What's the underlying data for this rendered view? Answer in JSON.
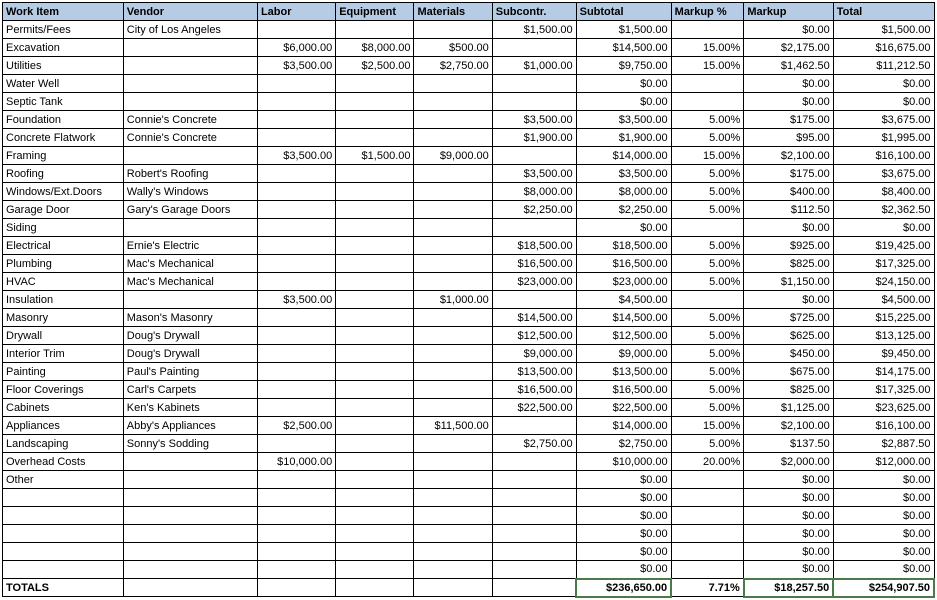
{
  "headers": [
    "Work Item",
    "Vendor",
    "Labor",
    "Equipment",
    "Materials",
    "Subcontr.",
    "Subtotal",
    "Markup %",
    "Markup",
    "Total"
  ],
  "rows": [
    {
      "work": "Permits/Fees",
      "vendor": "City of Los Angeles",
      "labor": "",
      "equip": "",
      "mat": "",
      "sub": "$1,500.00",
      "subt": "$1,500.00",
      "mpct": "",
      "mark": "$0.00",
      "total": "$1,500.00"
    },
    {
      "work": "Excavation",
      "vendor": "",
      "labor": "$6,000.00",
      "equip": "$8,000.00",
      "mat": "$500.00",
      "sub": "",
      "subt": "$14,500.00",
      "mpct": "15.00%",
      "mark": "$2,175.00",
      "total": "$16,675.00"
    },
    {
      "work": "Utilities",
      "vendor": "",
      "labor": "$3,500.00",
      "equip": "$2,500.00",
      "mat": "$2,750.00",
      "sub": "$1,000.00",
      "subt": "$9,750.00",
      "mpct": "15.00%",
      "mark": "$1,462.50",
      "total": "$11,212.50"
    },
    {
      "work": "Water Well",
      "vendor": "",
      "labor": "",
      "equip": "",
      "mat": "",
      "sub": "",
      "subt": "$0.00",
      "mpct": "",
      "mark": "$0.00",
      "total": "$0.00"
    },
    {
      "work": "Septic Tank",
      "vendor": "",
      "labor": "",
      "equip": "",
      "mat": "",
      "sub": "",
      "subt": "$0.00",
      "mpct": "",
      "mark": "$0.00",
      "total": "$0.00"
    },
    {
      "work": "Foundation",
      "vendor": "Connie's Concrete",
      "labor": "",
      "equip": "",
      "mat": "",
      "sub": "$3,500.00",
      "subt": "$3,500.00",
      "mpct": "5.00%",
      "mark": "$175.00",
      "total": "$3,675.00"
    },
    {
      "work": "Concrete Flatwork",
      "vendor": "Connie's Concrete",
      "labor": "",
      "equip": "",
      "mat": "",
      "sub": "$1,900.00",
      "subt": "$1,900.00",
      "mpct": "5.00%",
      "mark": "$95.00",
      "total": "$1,995.00"
    },
    {
      "work": "Framing",
      "vendor": "",
      "labor": "$3,500.00",
      "equip": "$1,500.00",
      "mat": "$9,000.00",
      "sub": "",
      "subt": "$14,000.00",
      "mpct": "15.00%",
      "mark": "$2,100.00",
      "total": "$16,100.00"
    },
    {
      "work": "Roofing",
      "vendor": "Robert's Roofing",
      "labor": "",
      "equip": "",
      "mat": "",
      "sub": "$3,500.00",
      "subt": "$3,500.00",
      "mpct": "5.00%",
      "mark": "$175.00",
      "total": "$3,675.00"
    },
    {
      "work": "Windows/Ext.Doors",
      "vendor": "Wally's Windows",
      "labor": "",
      "equip": "",
      "mat": "",
      "sub": "$8,000.00",
      "subt": "$8,000.00",
      "mpct": "5.00%",
      "mark": "$400.00",
      "total": "$8,400.00"
    },
    {
      "work": "Garage Door",
      "vendor": "Gary's Garage Doors",
      "labor": "",
      "equip": "",
      "mat": "",
      "sub": "$2,250.00",
      "subt": "$2,250.00",
      "mpct": "5.00%",
      "mark": "$112.50",
      "total": "$2,362.50"
    },
    {
      "work": "Siding",
      "vendor": "",
      "labor": "",
      "equip": "",
      "mat": "",
      "sub": "",
      "subt": "$0.00",
      "mpct": "",
      "mark": "$0.00",
      "total": "$0.00"
    },
    {
      "work": "Electrical",
      "vendor": "Ernie's Electric",
      "labor": "",
      "equip": "",
      "mat": "",
      "sub": "$18,500.00",
      "subt": "$18,500.00",
      "mpct": "5.00%",
      "mark": "$925.00",
      "total": "$19,425.00"
    },
    {
      "work": "Plumbing",
      "vendor": "Mac's Mechanical",
      "labor": "",
      "equip": "",
      "mat": "",
      "sub": "$16,500.00",
      "subt": "$16,500.00",
      "mpct": "5.00%",
      "mark": "$825.00",
      "total": "$17,325.00"
    },
    {
      "work": "HVAC",
      "vendor": "Mac's Mechanical",
      "labor": "",
      "equip": "",
      "mat": "",
      "sub": "$23,000.00",
      "subt": "$23,000.00",
      "mpct": "5.00%",
      "mark": "$1,150.00",
      "total": "$24,150.00"
    },
    {
      "work": "Insulation",
      "vendor": "",
      "labor": "$3,500.00",
      "equip": "",
      "mat": "$1,000.00",
      "sub": "",
      "subt": "$4,500.00",
      "mpct": "",
      "mark": "$0.00",
      "total": "$4,500.00"
    },
    {
      "work": "Masonry",
      "vendor": "Mason's Masonry",
      "labor": "",
      "equip": "",
      "mat": "",
      "sub": "$14,500.00",
      "subt": "$14,500.00",
      "mpct": "5.00%",
      "mark": "$725.00",
      "total": "$15,225.00"
    },
    {
      "work": "Drywall",
      "vendor": "Doug's Drywall",
      "labor": "",
      "equip": "",
      "mat": "",
      "sub": "$12,500.00",
      "subt": "$12,500.00",
      "mpct": "5.00%",
      "mark": "$625.00",
      "total": "$13,125.00"
    },
    {
      "work": "Interior Trim",
      "vendor": "Doug's Drywall",
      "labor": "",
      "equip": "",
      "mat": "",
      "sub": "$9,000.00",
      "subt": "$9,000.00",
      "mpct": "5.00%",
      "mark": "$450.00",
      "total": "$9,450.00"
    },
    {
      "work": "Painting",
      "vendor": "Paul's Painting",
      "labor": "",
      "equip": "",
      "mat": "",
      "sub": "$13,500.00",
      "subt": "$13,500.00",
      "mpct": "5.00%",
      "mark": "$675.00",
      "total": "$14,175.00"
    },
    {
      "work": "Floor Coverings",
      "vendor": "Carl's Carpets",
      "labor": "",
      "equip": "",
      "mat": "",
      "sub": "$16,500.00",
      "subt": "$16,500.00",
      "mpct": "5.00%",
      "mark": "$825.00",
      "total": "$17,325.00"
    },
    {
      "work": "Cabinets",
      "vendor": "Ken's Kabinets",
      "labor": "",
      "equip": "",
      "mat": "",
      "sub": "$22,500.00",
      "subt": "$22,500.00",
      "mpct": "5.00%",
      "mark": "$1,125.00",
      "total": "$23,625.00"
    },
    {
      "work": "Appliances",
      "vendor": "Abby's Appliances",
      "labor": "$2,500.00",
      "equip": "",
      "mat": "$11,500.00",
      "sub": "",
      "subt": "$14,000.00",
      "mpct": "15.00%",
      "mark": "$2,100.00",
      "total": "$16,100.00"
    },
    {
      "work": "Landscaping",
      "vendor": "Sonny's Sodding",
      "labor": "",
      "equip": "",
      "mat": "",
      "sub": "$2,750.00",
      "subt": "$2,750.00",
      "mpct": "5.00%",
      "mark": "$137.50",
      "total": "$2,887.50"
    },
    {
      "work": "Overhead Costs",
      "vendor": "",
      "labor": "$10,000.00",
      "equip": "",
      "mat": "",
      "sub": "",
      "subt": "$10,000.00",
      "mpct": "20.00%",
      "mark": "$2,000.00",
      "total": "$12,000.00"
    },
    {
      "work": "Other",
      "vendor": "",
      "labor": "",
      "equip": "",
      "mat": "",
      "sub": "",
      "subt": "$0.00",
      "mpct": "",
      "mark": "$0.00",
      "total": "$0.00"
    },
    {
      "work": "",
      "vendor": "",
      "labor": "",
      "equip": "",
      "mat": "",
      "sub": "",
      "subt": "$0.00",
      "mpct": "",
      "mark": "$0.00",
      "total": "$0.00"
    },
    {
      "work": "",
      "vendor": "",
      "labor": "",
      "equip": "",
      "mat": "",
      "sub": "",
      "subt": "$0.00",
      "mpct": "",
      "mark": "$0.00",
      "total": "$0.00"
    },
    {
      "work": "",
      "vendor": "",
      "labor": "",
      "equip": "",
      "mat": "",
      "sub": "",
      "subt": "$0.00",
      "mpct": "",
      "mark": "$0.00",
      "total": "$0.00"
    },
    {
      "work": "",
      "vendor": "",
      "labor": "",
      "equip": "",
      "mat": "",
      "sub": "",
      "subt": "$0.00",
      "mpct": "",
      "mark": "$0.00",
      "total": "$0.00"
    },
    {
      "work": "",
      "vendor": "",
      "labor": "",
      "equip": "",
      "mat": "",
      "sub": "",
      "subt": "$0.00",
      "mpct": "",
      "mark": "$0.00",
      "total": "$0.00"
    }
  ],
  "totals": {
    "label": "TOTALS",
    "subt": "$236,650.00",
    "mpct": "7.71%",
    "mark": "$18,257.50",
    "total": "$254,907.50"
  }
}
